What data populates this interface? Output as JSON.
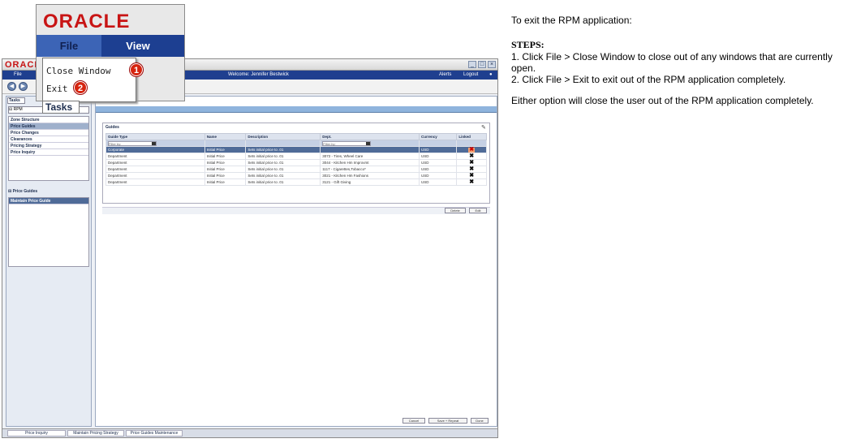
{
  "app": {
    "logo": "ORACLE",
    "menu": {
      "file": "File",
      "alerts": "Alerts",
      "logout": "Logout"
    },
    "welcome": "Welcome: Jennifer Bestwick",
    "left_panel": {
      "tasks_tab": "Tasks",
      "rpm_label": "RPM",
      "tree_items": [
        "Zone Structure",
        "Price Guides",
        "Price Changes",
        "Clearances",
        "Pricing Strategy",
        "Price Inquiry"
      ],
      "price_guides_header": "Price Guides",
      "price_guides_items": [
        "Maintain Price Guide"
      ]
    },
    "guides": {
      "title": "Guides",
      "columns": [
        "Guide Type",
        "Name",
        "Description",
        "Dept.",
        "Currency",
        "Linked"
      ],
      "filter_placeholder": "Filter by:",
      "rows": [
        [
          "Corporate",
          "Initial Price",
          "Sets initial price to .01",
          "",
          "USD",
          "x"
        ],
        [
          "Department",
          "Initial Price",
          "Sets initial price to .01",
          "3072 - Tires, Wheel Care",
          "USD",
          "x"
        ],
        [
          "Department",
          "Initial Price",
          "Sets initial price to .01",
          "3044 - Kitchen Hm Improvmt",
          "USD",
          "x"
        ],
        [
          "Department",
          "Initial Price",
          "Sets initial price to .01",
          "1117 - Cigarettes,Tobacco*",
          "USD",
          "x"
        ],
        [
          "Department",
          "Initial Price",
          "Sets initial price to .01",
          "3021 - Kitchen Hm Fashions",
          "USD",
          "x"
        ],
        [
          "Department",
          "Initial Price",
          "Sets initial price to .01",
          "3121 - Gift Giving",
          "USD",
          "x"
        ]
      ],
      "delete_label": "Delete",
      "edit_label": "Edit"
    },
    "footer_buttons": {
      "cancel": "Cancel",
      "save_repeat": "Save + Repeat",
      "done": "Done"
    },
    "status_tabs": [
      "Price Inquiry",
      "Maintain Pricing Strategy",
      "Price Guides Maintenance"
    ]
  },
  "zoom": {
    "logo": "ORACLE",
    "file": "File",
    "view": "View",
    "menu_items": [
      {
        "label": "Close Window",
        "badge": "1"
      },
      {
        "label": "Exit",
        "badge": "2"
      }
    ],
    "tasks_label": "Tasks"
  },
  "instructions": {
    "intro": "To exit the RPM application:",
    "steps_header": "STEPS:",
    "step1": "1.  Click File > Close Window to close out of any windows that are currently open.",
    "step2": "2.  Click File > Exit to exit out of the RPM application completely.",
    "note": "Either option will close the user out of the RPM application completely."
  }
}
